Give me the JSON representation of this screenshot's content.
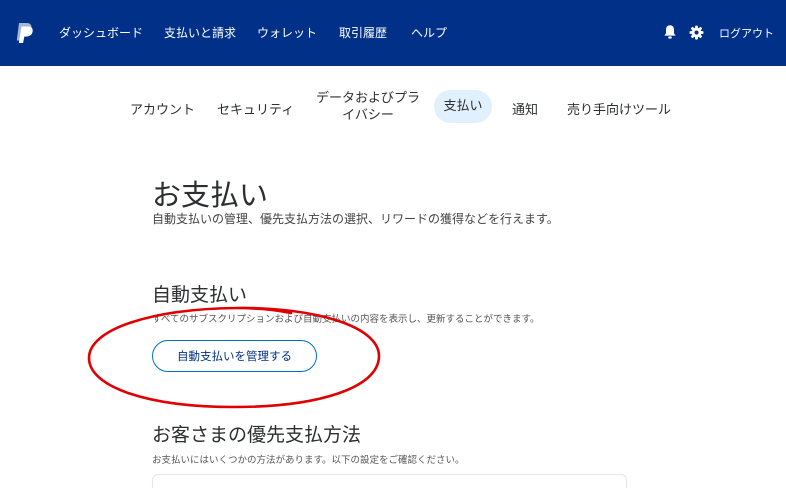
{
  "topnav": {
    "links": [
      "ダッシュボード",
      "支払いと請求",
      "ウォレット",
      "取引履歴",
      "ヘルプ"
    ],
    "logout": "ログアウト",
    "bg_color": "#003087"
  },
  "subnav": {
    "tabs": [
      "アカウント",
      "セキュリティ",
      "データおよびプライバシー",
      "支払い",
      "通知",
      "売り手向けツール"
    ],
    "active_tab": "支払い"
  },
  "page": {
    "title": "お支払い",
    "subtitle": "自動支払いの管理、優先支払方法の選択、リワードの獲得などを行えます。"
  },
  "autopay": {
    "title": "自動支払い",
    "description": "すべてのサブスクリプションおよび自動支払いの内容を表示し、更新することができます。",
    "button_label": "自動支払いを管理する"
  },
  "preferred": {
    "title": "お客さまの優先支払方法",
    "description": "お支払いにはいくつかの方法があります。以下の設定をご確認ください。"
  },
  "colors": {
    "accent": "#0070ba",
    "active_tab_bg": "#e1f0fd",
    "annotation": "#e00000"
  }
}
